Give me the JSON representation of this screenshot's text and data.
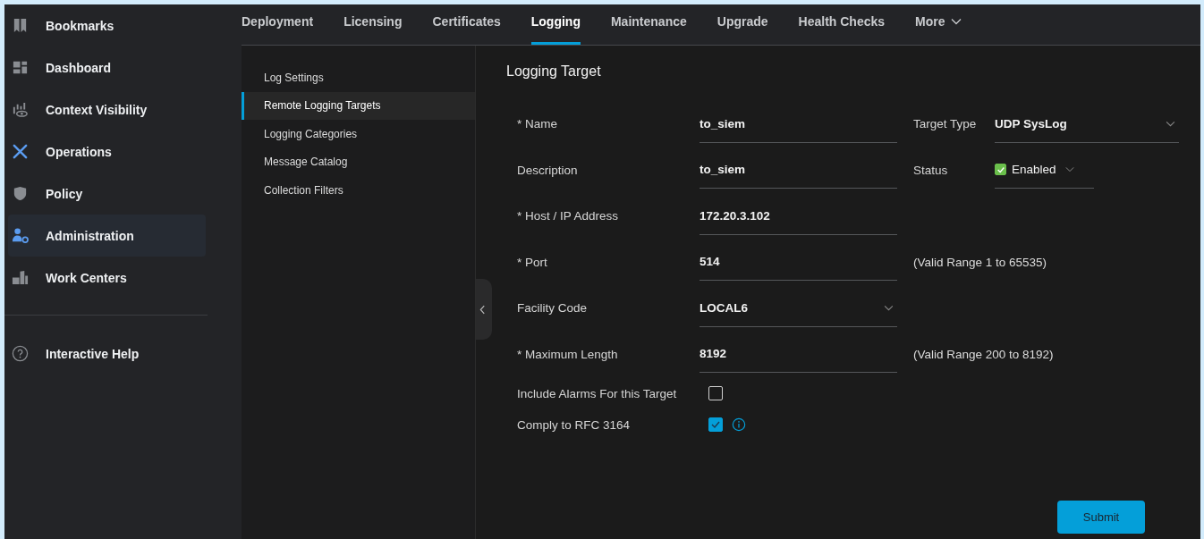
{
  "sidebar": {
    "items": [
      {
        "label": "Bookmarks",
        "selected": false
      },
      {
        "label": "Dashboard",
        "selected": false
      },
      {
        "label": "Context Visibility",
        "selected": false
      },
      {
        "label": "Operations",
        "selected": false
      },
      {
        "label": "Policy",
        "selected": false
      },
      {
        "label": "Administration",
        "selected": true
      },
      {
        "label": "Work Centers",
        "selected": false
      }
    ],
    "help": {
      "label": "Interactive Help"
    }
  },
  "tabs": [
    {
      "label": "Deployment",
      "selected": false
    },
    {
      "label": "Licensing",
      "selected": false
    },
    {
      "label": "Certificates",
      "selected": false
    },
    {
      "label": "Logging",
      "selected": true
    },
    {
      "label": "Maintenance",
      "selected": false
    },
    {
      "label": "Upgrade",
      "selected": false
    },
    {
      "label": "Health Checks",
      "selected": false
    },
    {
      "label": "More",
      "selected": false,
      "kind": "menu"
    }
  ],
  "subnav": [
    {
      "label": "Log Settings",
      "selected": false
    },
    {
      "label": "Remote Logging Targets",
      "selected": true
    },
    {
      "label": "Logging Categories",
      "selected": false
    },
    {
      "label": "Message Catalog",
      "selected": false
    },
    {
      "label": "Collection Filters",
      "selected": false
    }
  ],
  "form": {
    "title": "Logging Target",
    "rows": [
      {
        "label": "* Name",
        "value": "to_siem",
        "kind": "text",
        "aside": {
          "kind": "select",
          "label": "Target Type",
          "value": "UDP SysLog"
        }
      },
      {
        "label": "Description",
        "value": "to_siem",
        "kind": "text",
        "aside": {
          "kind": "status",
          "label": "Status",
          "value": "Enabled",
          "checked": true
        }
      },
      {
        "label": "* Host / IP Address",
        "value": "172.20.3.102",
        "kind": "text"
      },
      {
        "label": "* Port",
        "value": "514",
        "kind": "text",
        "aside": {
          "kind": "hint",
          "label": "(Valid Range 1 to 65535)"
        }
      },
      {
        "label": "Facility Code",
        "value": "LOCAL6",
        "kind": "select"
      },
      {
        "label": "* Maximum Length",
        "value": "8192",
        "kind": "text",
        "aside": {
          "kind": "hint",
          "label": "(Valid Range 200 to 8192)"
        }
      }
    ],
    "checks": [
      {
        "label": "Include Alarms For this Target",
        "checked": false,
        "info": false
      },
      {
        "label": "Comply to RFC 3164",
        "checked": true,
        "info": true
      }
    ],
    "submit": "Submit"
  }
}
